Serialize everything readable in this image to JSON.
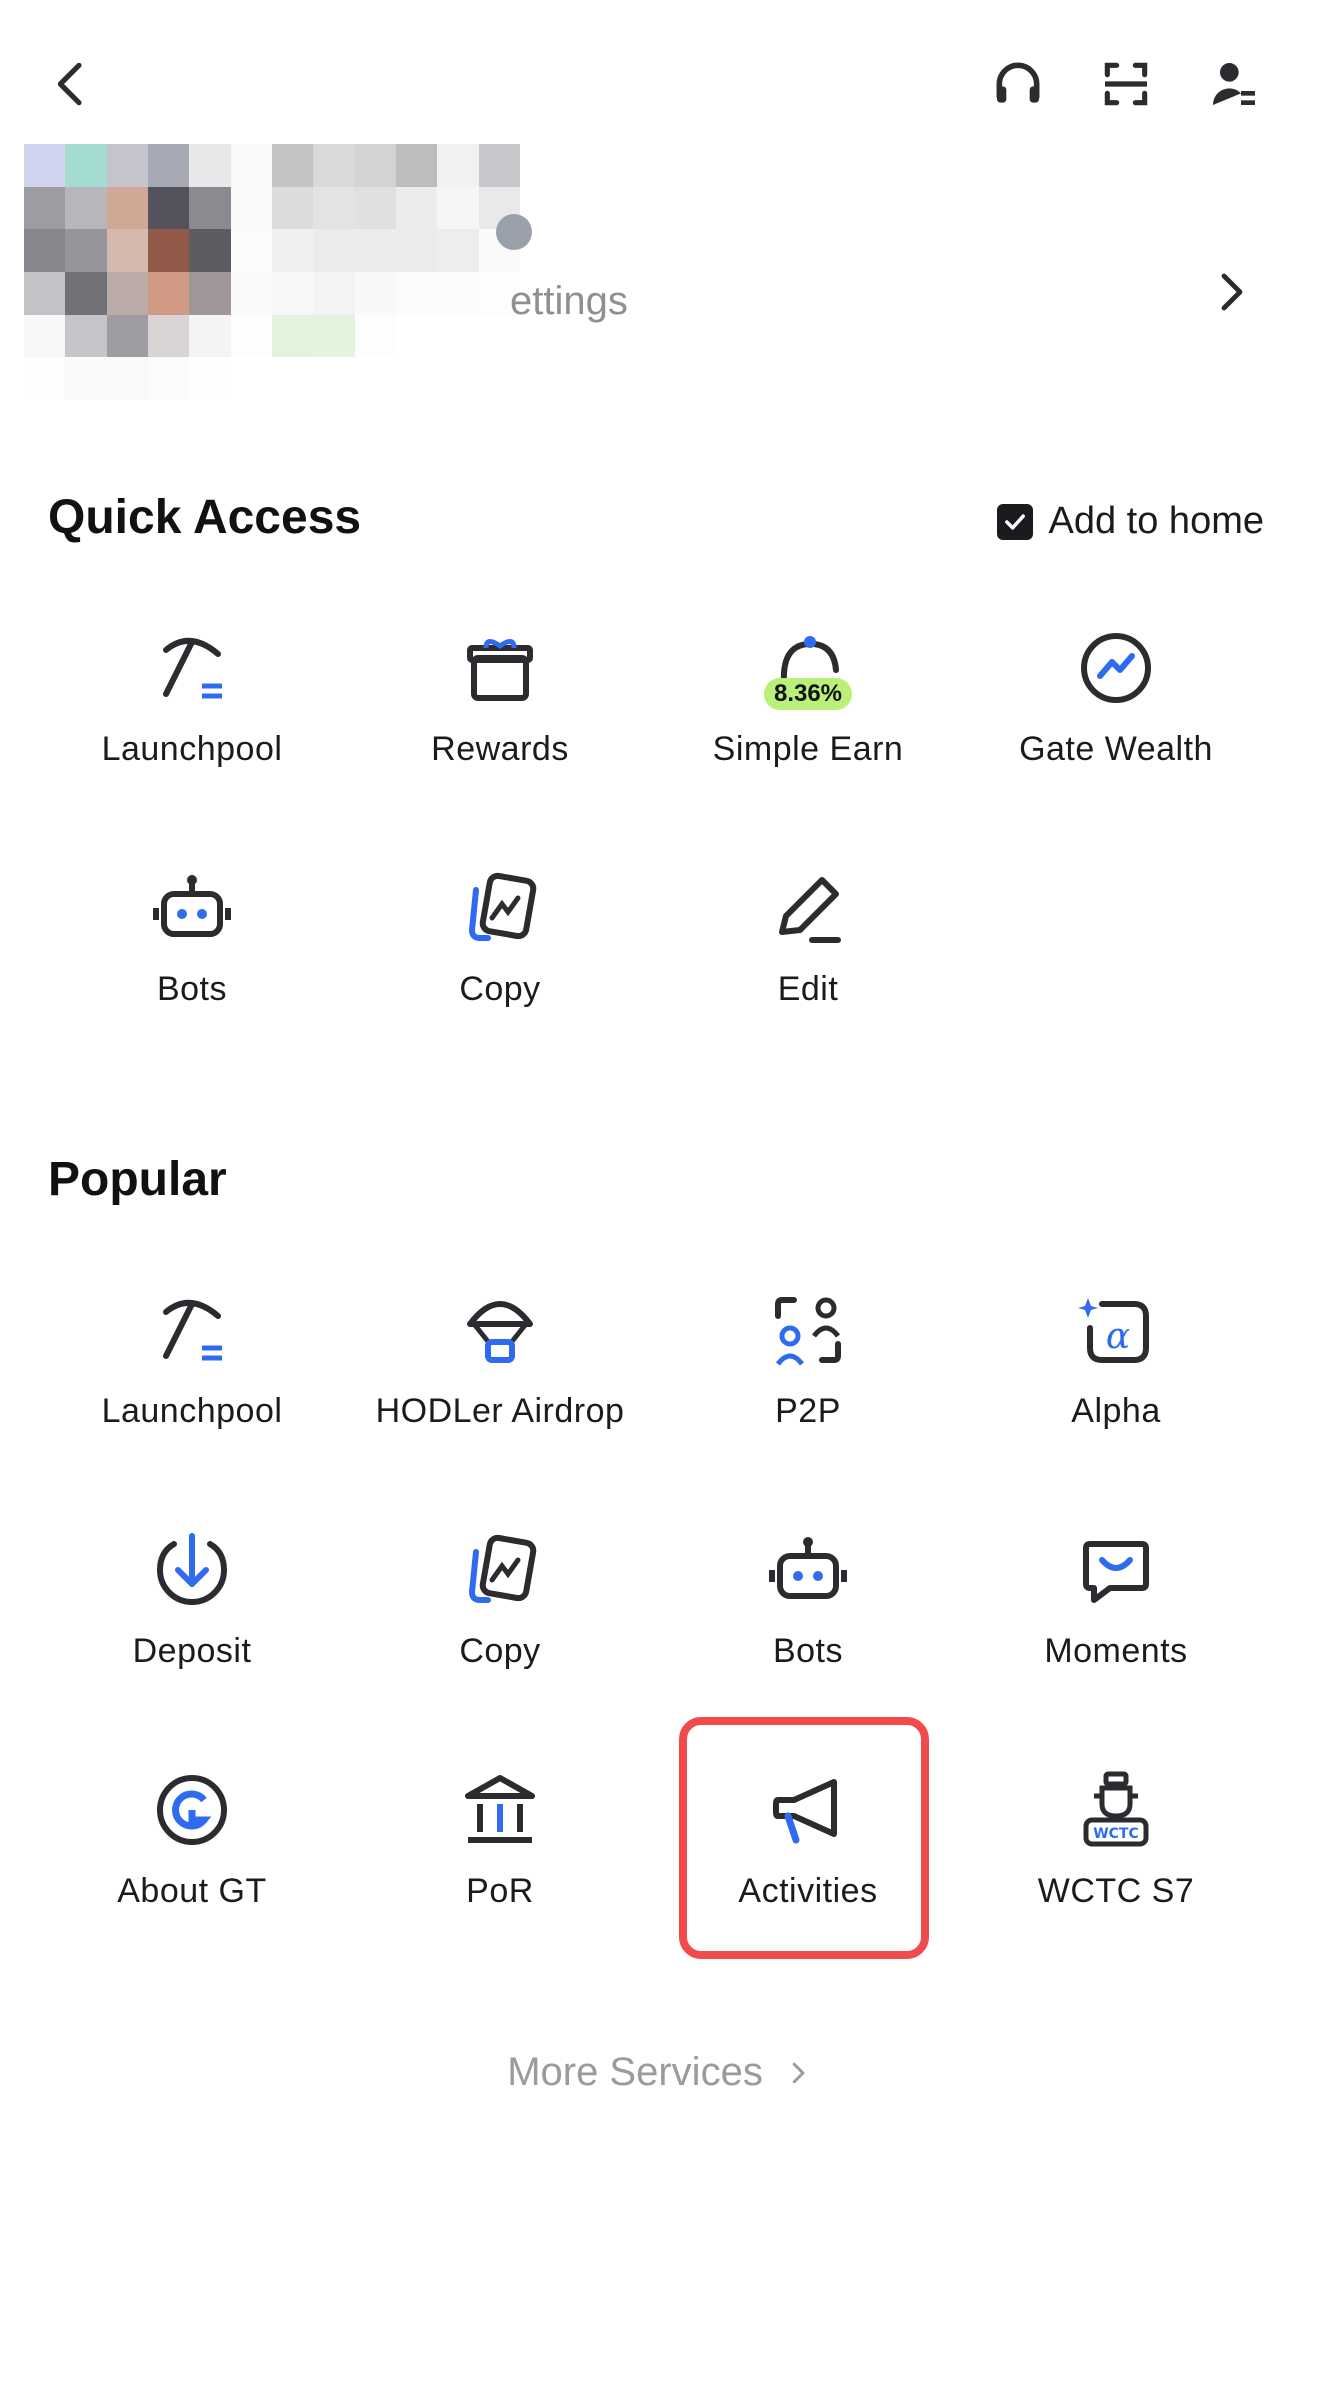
{
  "profile": {
    "subtitle": "ettings"
  },
  "quick_access": {
    "title": "Quick Access",
    "add_to_home": "Add to home",
    "items": [
      {
        "label": "Launchpool",
        "icon": "pickaxe-icon"
      },
      {
        "label": "Rewards",
        "icon": "gift-icon"
      },
      {
        "label": "Simple Earn",
        "icon": "piggy-bank-icon",
        "badge": "8.36%"
      },
      {
        "label": "Gate Wealth",
        "icon": "wealth-chart-icon"
      },
      {
        "label": "Bots",
        "icon": "robot-icon"
      },
      {
        "label": "Copy",
        "icon": "copy-trade-icon"
      },
      {
        "label": "Edit",
        "icon": "pencil-icon"
      }
    ]
  },
  "popular": {
    "title": "Popular",
    "items": [
      {
        "label": "Launchpool",
        "icon": "pickaxe-icon"
      },
      {
        "label": "HODLer Airdrop",
        "icon": "parachute-icon"
      },
      {
        "label": "P2P",
        "icon": "p2p-users-icon"
      },
      {
        "label": "Alpha",
        "icon": "alpha-icon"
      },
      {
        "label": "Deposit",
        "icon": "deposit-arrow-icon"
      },
      {
        "label": "Copy",
        "icon": "copy-trade-icon"
      },
      {
        "label": "Bots",
        "icon": "robot-icon"
      },
      {
        "label": "Moments",
        "icon": "chat-smile-icon"
      },
      {
        "label": "About GT",
        "icon": "gt-logo-icon"
      },
      {
        "label": "PoR",
        "icon": "bank-building-icon"
      },
      {
        "label": "Activities",
        "icon": "megaphone-icon"
      },
      {
        "label": "WCTC S7",
        "icon": "trophy-icon",
        "icon_text": "WCTC"
      }
    ]
  },
  "more_services": "More Services",
  "colors": {
    "accent": "#2f6bf0",
    "icon_dark": "#2b2b30",
    "highlight": "#f04a4a",
    "badge": "#b8f07a"
  }
}
